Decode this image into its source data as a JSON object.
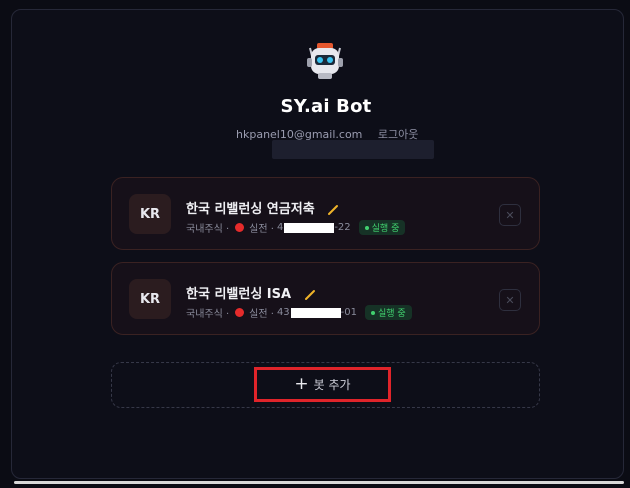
{
  "app": {
    "title": "SY.ai Bot",
    "email": "hkpanel10@gmail.com",
    "logout_label": "로그아웃"
  },
  "bots": [
    {
      "badge": "KR",
      "name": "한국 리밸런싱 연금저축",
      "market": "국내주식 ·",
      "mode": "실전 ·",
      "account_prefix": "4",
      "account_suffix": "-22",
      "status": "실행 중"
    },
    {
      "badge": "KR",
      "name": "한국 리밸런싱 ISA",
      "market": "국내주식 ·",
      "mode": "실전 ·",
      "account_prefix": "43",
      "account_suffix": "-01",
      "status": "실행 중"
    }
  ],
  "add_bot": {
    "label": "봇 추가"
  },
  "colors": {
    "status_green": "#41d16f",
    "live_dot": "#e52b2b",
    "highlight_box": "#e0242a",
    "edit_pencil": "#f0b429"
  },
  "icons": {
    "logo": "robot-icon",
    "edit": "pencil-icon",
    "remove": "close-icon",
    "add": "plus-icon"
  }
}
